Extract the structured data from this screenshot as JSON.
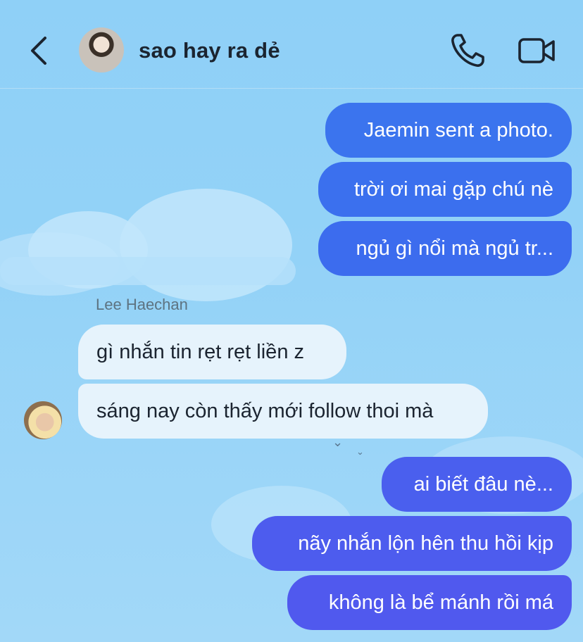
{
  "header": {
    "title": "sao hay ra dẻ"
  },
  "messages": {
    "outgoing_1": [
      "Jaemin sent a photo.",
      "trời ơi mai gặp chú nè",
      "ngủ gì nổi mà ngủ tr..."
    ],
    "sender_name": "Lee Haechan",
    "incoming": [
      "gì nhắn tin rẹt rẹt liền z",
      "sáng nay còn thấy mới follow thoi mà"
    ],
    "outgoing_2": [
      "ai biết đâu nè...",
      "nãy nhắn lộn hên thu hồi kịp",
      "không là bể mánh rồi má"
    ]
  },
  "colors": {
    "outgoing_top": "#3b72ee",
    "outgoing_bottom": "#4e5cee",
    "incoming_bg": "#e6f3fc",
    "background": "#93d2f7"
  },
  "icons": {
    "back": "chevron-left-icon",
    "call": "phone-icon",
    "video": "video-camera-icon"
  }
}
